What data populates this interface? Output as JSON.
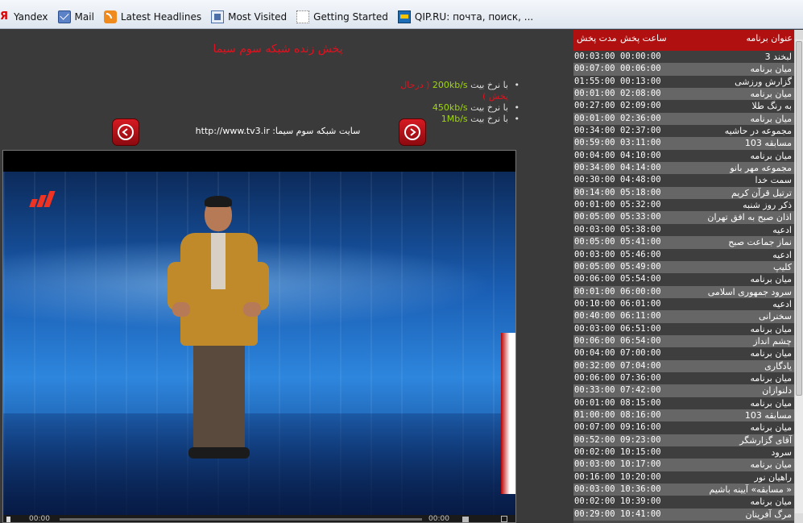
{
  "bookmarks": [
    {
      "label": "Yandex",
      "icon": "yandex-icon"
    },
    {
      "label": "Mail",
      "icon": "mail-icon"
    },
    {
      "label": "Latest Headlines",
      "icon": "rss-icon"
    },
    {
      "label": "Most Visited",
      "icon": "most-visited-icon"
    },
    {
      "label": "Getting Started",
      "icon": "page-icon"
    },
    {
      "label": "QIP.RU: почта, поиск, ...",
      "icon": "qip-icon"
    }
  ],
  "page": {
    "title": "پخش زنده شبکه سوم سیما",
    "site_text": "سایت شبکه سوم سیما: http://www.tv3.ir"
  },
  "bitrates": [
    {
      "prefix": "با نرخ بیت ",
      "rate": "200kb/s",
      "note": " ( درحال پخش )"
    },
    {
      "prefix": "با نرخ بیت ",
      "rate": "450kb/s",
      "note": ""
    },
    {
      "prefix": "با نرخ بیت ",
      "rate": "1Mb/s",
      "note": ""
    }
  ],
  "player": {
    "time_elapsed": "00:00",
    "time_total": "00:00"
  },
  "schedule": {
    "headers": {
      "title": "عنوان برنامه",
      "start": "ساعت پخش",
      "duration": "مدت پخش"
    },
    "rows": [
      {
        "title": "لبخند 3",
        "start": "00:00:00",
        "duration": "00:03:00"
      },
      {
        "title": "میان برنامه",
        "start": "00:06:00",
        "duration": "00:07:00"
      },
      {
        "title": "گزارش ورزشی",
        "start": "00:13:00",
        "duration": "01:55:00"
      },
      {
        "title": "میان برنامه",
        "start": "02:08:00",
        "duration": "00:01:00"
      },
      {
        "title": "به رنگ طلا",
        "start": "02:09:00",
        "duration": "00:27:00"
      },
      {
        "title": "میان برنامه",
        "start": "02:36:00",
        "duration": "00:01:00"
      },
      {
        "title": "مجموعه در حاشیه",
        "start": "02:37:00",
        "duration": "00:34:00"
      },
      {
        "title": "مسابقه 103",
        "start": "03:11:00",
        "duration": "00:59:00"
      },
      {
        "title": "میان برنامه",
        "start": "04:10:00",
        "duration": "00:04:00"
      },
      {
        "title": "مجموعه مهر بانو",
        "start": "04:14:00",
        "duration": "00:34:00"
      },
      {
        "title": "سمت خدا",
        "start": "04:48:00",
        "duration": "00:30:00"
      },
      {
        "title": "ترتیل قرآن کریم",
        "start": "05:18:00",
        "duration": "00:14:00"
      },
      {
        "title": "ذکر روز شنبه",
        "start": "05:32:00",
        "duration": "00:01:00"
      },
      {
        "title": "اذان صبح به افق تهران",
        "start": "05:33:00",
        "duration": "00:05:00"
      },
      {
        "title": "ادعیه",
        "start": "05:38:00",
        "duration": "00:03:00"
      },
      {
        "title": "نماز جماعت صبح",
        "start": "05:41:00",
        "duration": "00:05:00"
      },
      {
        "title": "ادعیه",
        "start": "05:46:00",
        "duration": "00:03:00"
      },
      {
        "title": "کلیپ",
        "start": "05:49:00",
        "duration": "00:05:00"
      },
      {
        "title": "میان برنامه",
        "start": "05:54:00",
        "duration": "00:06:00"
      },
      {
        "title": "سرود جمهوری اسلامی",
        "start": "06:00:00",
        "duration": "00:01:00"
      },
      {
        "title": "ادعیه",
        "start": "06:01:00",
        "duration": "00:10:00"
      },
      {
        "title": "سخنرانی",
        "start": "06:11:00",
        "duration": "00:40:00"
      },
      {
        "title": "میان برنامه",
        "start": "06:51:00",
        "duration": "00:03:00"
      },
      {
        "title": "چشم انداز",
        "start": "06:54:00",
        "duration": "00:06:00"
      },
      {
        "title": "میان برنامه",
        "start": "07:00:00",
        "duration": "00:04:00"
      },
      {
        "title": "یادگاری",
        "start": "07:04:00",
        "duration": "00:32:00"
      },
      {
        "title": "میان برنامه",
        "start": "07:36:00",
        "duration": "00:06:00"
      },
      {
        "title": "دلنوازان",
        "start": "07:42:00",
        "duration": "00:33:00"
      },
      {
        "title": "میان برنامه",
        "start": "08:15:00",
        "duration": "00:01:00"
      },
      {
        "title": "مسابقه 103",
        "start": "08:16:00",
        "duration": "01:00:00"
      },
      {
        "title": "میان برنامه",
        "start": "09:16:00",
        "duration": "00:07:00"
      },
      {
        "title": "آقای گزارشگر",
        "start": "09:23:00",
        "duration": "00:52:00"
      },
      {
        "title": "سرود",
        "start": "10:15:00",
        "duration": "00:02:00"
      },
      {
        "title": "میان برنامه",
        "start": "10:17:00",
        "duration": "00:03:00"
      },
      {
        "title": "راهیان نور",
        "start": "10:20:00",
        "duration": "00:16:00"
      },
      {
        "title": "« مسابقه» آیینه باشیم",
        "start": "10:36:00",
        "duration": "00:03:00"
      },
      {
        "title": "میان برنامه",
        "start": "10:39:00",
        "duration": "00:02:00"
      },
      {
        "title": "مرگ آفرینان",
        "start": "10:41:00",
        "duration": "00:29:00"
      }
    ]
  },
  "colors": {
    "accent_red": "#e0121f",
    "rate_green": "#9fd80a",
    "header_red": "#b01010"
  }
}
